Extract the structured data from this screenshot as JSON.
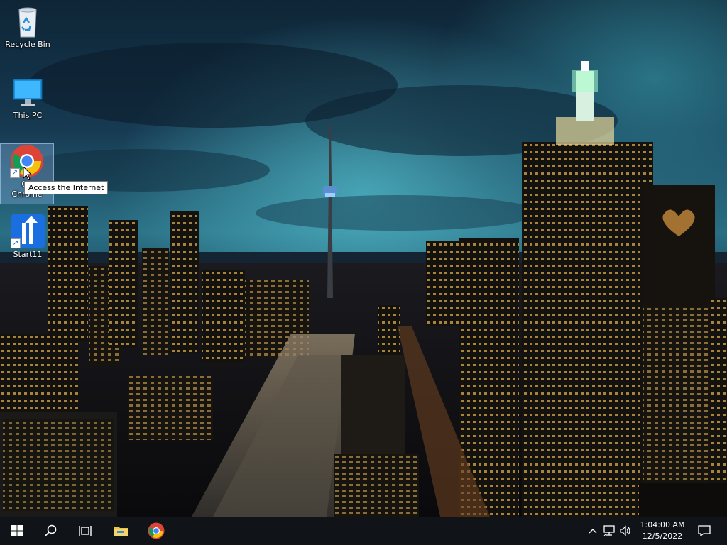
{
  "desktop": {
    "icons": [
      {
        "label": "Recycle Bin"
      },
      {
        "label": "This PC"
      },
      {
        "label": "Google Chrome",
        "label_line1": "Go",
        "label_line2": "Chrome"
      },
      {
        "label": "Start11"
      }
    ],
    "tooltip": "Access the Internet"
  },
  "taskbar": {
    "buttons": [
      {
        "icon": "windows-start-icon"
      },
      {
        "icon": "search-icon"
      },
      {
        "icon": "task-view-icon"
      },
      {
        "icon": "file-explorer-icon"
      },
      {
        "icon": "chrome-icon"
      }
    ],
    "tray": [
      {
        "icon": "chevron-up-icon"
      },
      {
        "icon": "network-icon"
      },
      {
        "icon": "volume-icon"
      }
    ],
    "clock": {
      "time": "1:04:00 AM",
      "date": "12/5/2022"
    },
    "accent": "#76b9ed"
  }
}
